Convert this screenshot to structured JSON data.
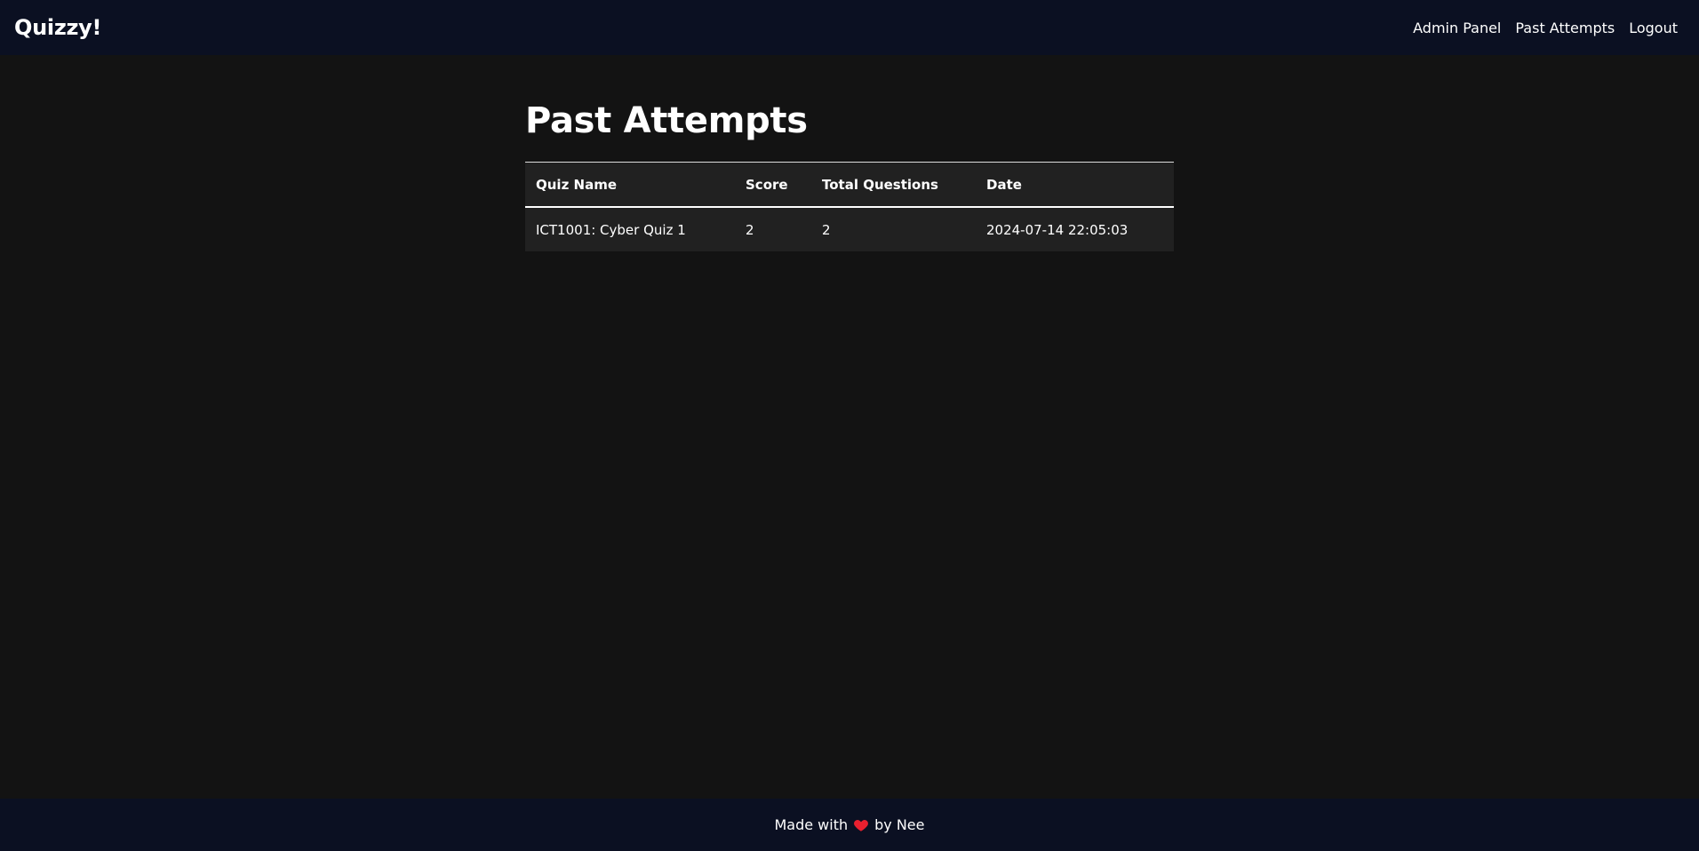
{
  "navbar": {
    "brand": "Quizzy!",
    "links": [
      {
        "label": "Admin Panel"
      },
      {
        "label": "Past Attempts"
      },
      {
        "label": "Logout"
      }
    ]
  },
  "main": {
    "title": "Past Attempts",
    "table": {
      "headers": [
        "Quiz Name",
        "Score",
        "Total Questions",
        "Date"
      ],
      "rows": [
        [
          "ICT1001: Cyber Quiz 1",
          "2",
          "2",
          "2024-07-14 22:05:03"
        ]
      ]
    }
  },
  "footer": {
    "text_before": "Made with",
    "icon": "heart-icon",
    "text_after": "by Nee"
  },
  "colors": {
    "navbar_bg": "#0b1022",
    "page_bg": "#131313",
    "table_bg": "#212121",
    "heart": "#e8202f"
  }
}
